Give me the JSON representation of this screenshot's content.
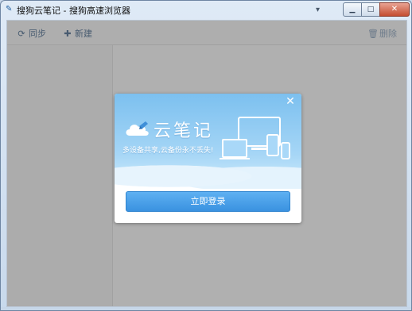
{
  "window": {
    "title": "搜狗云笔记 - 搜狗高速浏览器",
    "app_icon": "pen-icon",
    "controls": {
      "pin": "pin-icon",
      "minimize": "minimize-icon",
      "maximize": "maximize-icon",
      "close": "close-icon"
    }
  },
  "toolbar": {
    "sync_label": "同步",
    "sync_icon": "refresh-icon",
    "new_label": "新建",
    "new_icon": "plus-icon",
    "delete_label": "删除",
    "delete_icon": "trash-icon"
  },
  "dialog": {
    "close_icon": "close-icon",
    "logo_icon": "cloud-pen-icon",
    "logo_text": "云笔记",
    "slogan": "多设备共享,云备份永不丢失!",
    "devices_icon": "devices-icon",
    "login_button": "立即登录"
  },
  "colors": {
    "accent": "#3a92e0",
    "banner": "#8cc8f2",
    "overlay": "#6b6b6b"
  }
}
